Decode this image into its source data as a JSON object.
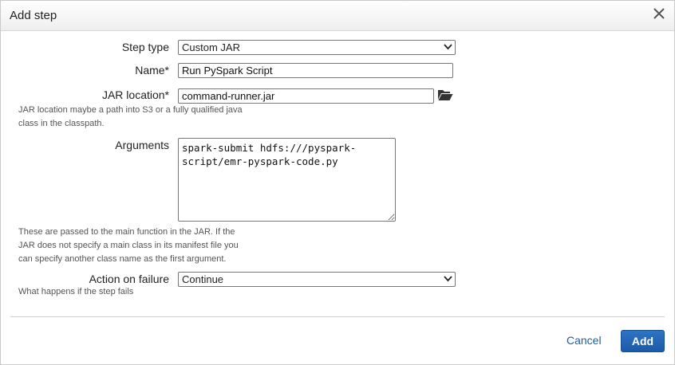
{
  "dialog": {
    "title": "Add step",
    "close_icon": "close-icon"
  },
  "form": {
    "step_type": {
      "label": "Step type",
      "value": "Custom JAR"
    },
    "name": {
      "label": "Name*",
      "value": "Run PySpark Script"
    },
    "jar_location": {
      "label": "JAR location*",
      "value": "command-runner.jar",
      "help_line1": "JAR location maybe a path into S3 or a fully qualified java",
      "help_line2": "class in the classpath.",
      "browse_icon": "folder-open-icon"
    },
    "arguments": {
      "label": "Arguments",
      "value": "spark-submit hdfs:///pyspark-\nscript/emr-pyspark-code.py",
      "help_line1": "These are passed to the main function in the JAR. If the",
      "help_line2": "JAR does not specify a main class in its manifest file you",
      "help_line3": "can specify another class name as the first argument."
    },
    "action_on_failure": {
      "label": "Action on failure",
      "value": "Continue",
      "help": "What happens if the step fails"
    }
  },
  "footer": {
    "cancel_label": "Cancel",
    "add_label": "Add"
  }
}
